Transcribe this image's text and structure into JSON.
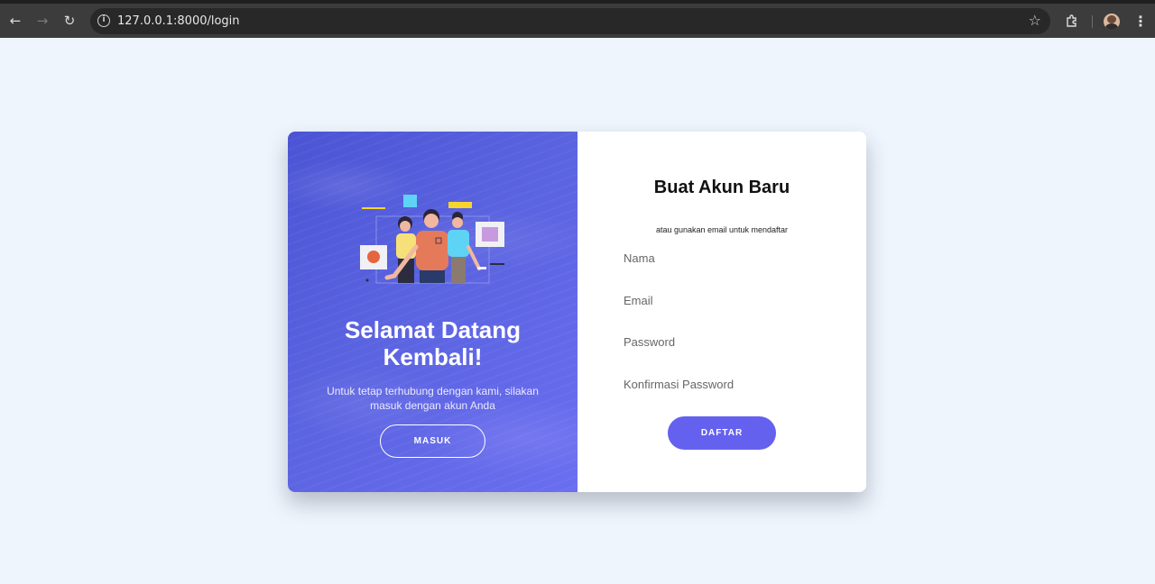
{
  "browser": {
    "url": "127.0.0.1:8000/login",
    "icons": {
      "back": "back-arrow-icon",
      "forward": "forward-arrow-icon",
      "reload": "reload-icon",
      "info": "site-info-icon",
      "bookmark": "star-icon",
      "extensions": "puzzle-icon",
      "profile": "avatar",
      "menu": "kebab-menu-icon"
    }
  },
  "welcome_panel": {
    "title": "Selamat Datang Kembali!",
    "subtitle": "Untuk tetap terhubung dengan kami, silakan masuk dengan akun Anda",
    "login_button": "MASUK",
    "background_color": "#5a63e0"
  },
  "register_form": {
    "title": "Buat Akun Baru",
    "subtitle": "atau gunakan email untuk mendaftar",
    "fields": {
      "name_placeholder": "Nama",
      "email_placeholder": "Email",
      "password_placeholder": "Password",
      "confirm_placeholder": "Konfirmasi Password"
    },
    "submit_button": "DAFTAR",
    "accent_color": "#6461ef"
  },
  "page": {
    "background_color": "#eef5fd"
  }
}
